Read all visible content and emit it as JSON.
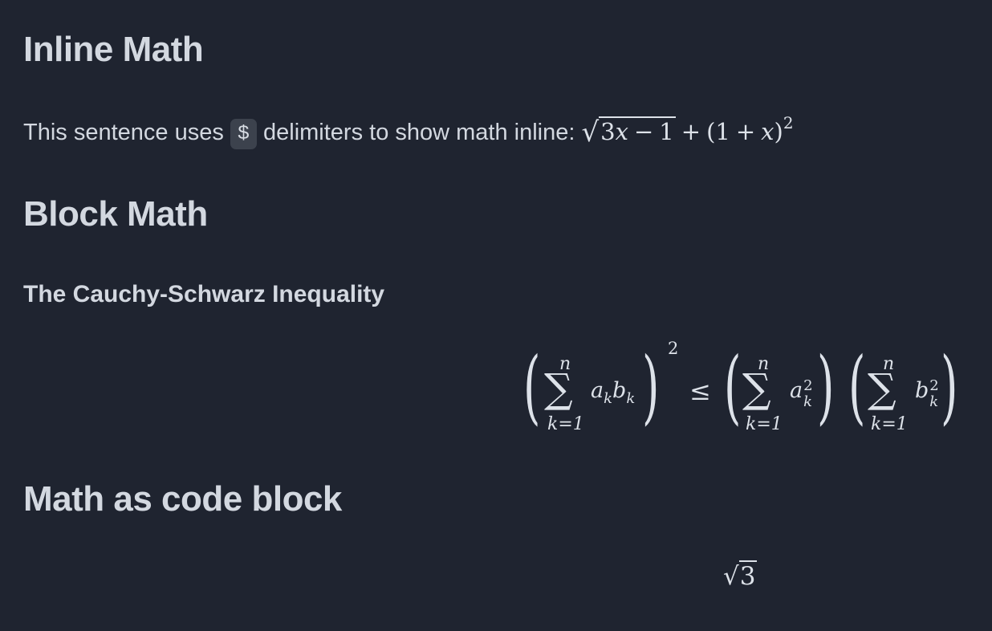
{
  "headings": {
    "inline": "Inline Math",
    "block": "Block Math",
    "code": "Math as code block"
  },
  "inline_section": {
    "text_before": "This sentence uses ",
    "code_chip": "$",
    "text_after": " delimiters to show math inline: ",
    "math": {
      "radicand_num": "3",
      "radicand_var": "x",
      "minus": "−",
      "one": "1",
      "plus1": "+",
      "open_paren": "(",
      "one_b": "1",
      "plus2": "+",
      "var_x": "x",
      "close_paren": ")",
      "exponent": "2"
    }
  },
  "block_section": {
    "subheading": "The Cauchy-Schwarz Inequality",
    "equation": {
      "sigma": "∑",
      "upper": "n",
      "lower": "k=1",
      "term1_a": "a",
      "term1_k": "k",
      "term1_b": "b",
      "term1_k2": "k",
      "outer_exponent": "2",
      "relation": "≤",
      "term2": "a",
      "term2_sup": "2",
      "term2_sub": "k",
      "term3": "b",
      "term3_sup": "2",
      "term3_sub": "k",
      "lparen": "(",
      "rparen": ")"
    }
  },
  "code_section": {
    "radical": "√",
    "radicand": "3"
  }
}
